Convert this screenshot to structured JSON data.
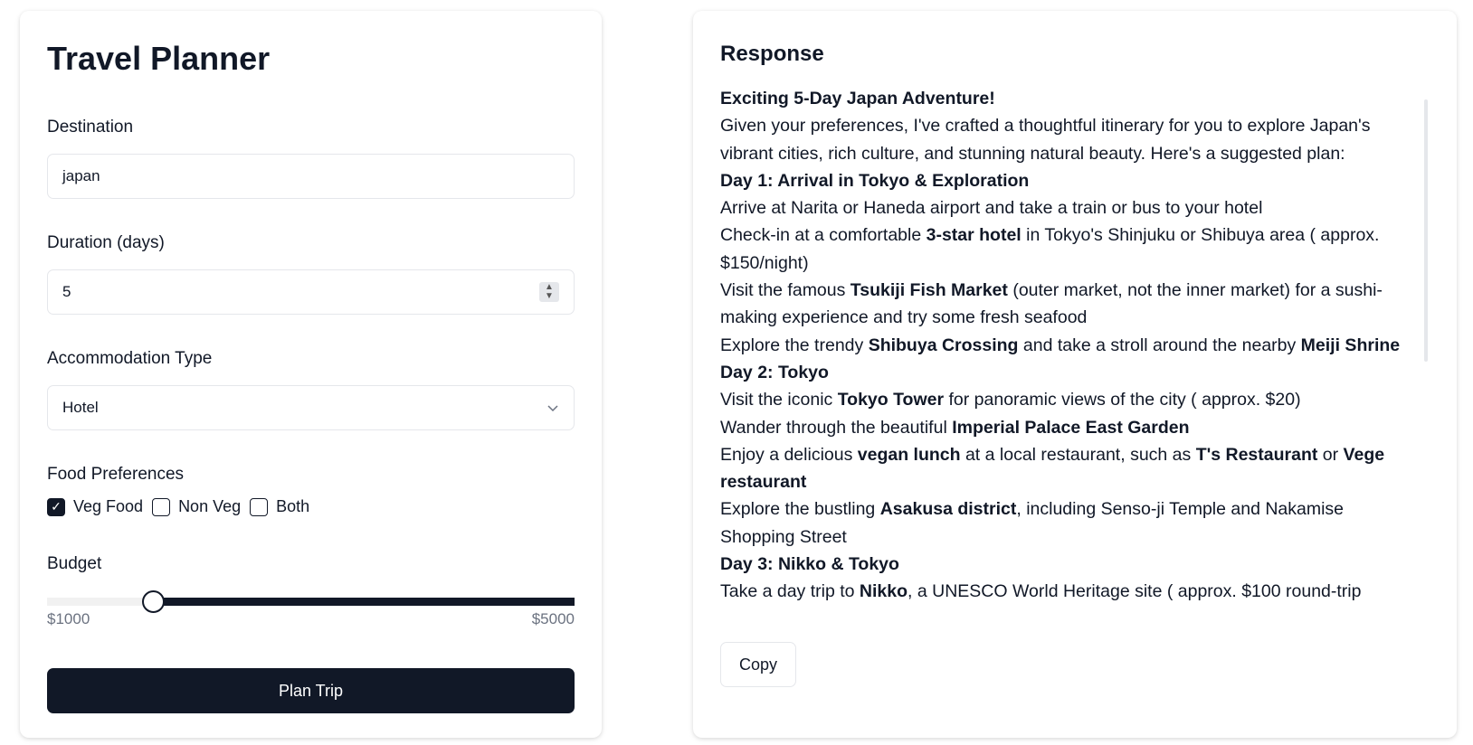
{
  "planner": {
    "title": "Travel Planner",
    "destination": {
      "label": "Destination",
      "value": "japan"
    },
    "duration": {
      "label": "Duration (days)",
      "value": "5"
    },
    "accommodation": {
      "label": "Accommodation Type",
      "value": "Hotel"
    },
    "food": {
      "label": "Food Preferences",
      "options": [
        {
          "label": "Veg Food",
          "checked": true
        },
        {
          "label": "Non Veg",
          "checked": false
        },
        {
          "label": "Both",
          "checked": false
        }
      ]
    },
    "budget": {
      "label": "Budget",
      "min_label": "$1000",
      "max_label": "$5000",
      "min": 1000,
      "max": 5000,
      "value": 1800
    },
    "submit_label": "Plan Trip"
  },
  "response": {
    "title": "Response",
    "copy_label": "Copy",
    "lines": [
      [
        {
          "t": "Exciting 5-Day Japan Adventure!",
          "b": true
        }
      ],
      [
        {
          "t": "Given your preferences, I've crafted a thoughtful itinerary for you to explore Japan's vibrant cities, rich culture, and stunning natural beauty. Here's a suggested plan:"
        }
      ],
      [
        {
          "t": "Day 1: Arrival in Tokyo & Exploration",
          "b": true
        }
      ],
      [
        {
          "t": "Arrive at Narita or Haneda airport and take a train or bus to your hotel"
        }
      ],
      [
        {
          "t": "Check-in at a comfortable "
        },
        {
          "t": "3-star hotel",
          "b": true
        },
        {
          "t": " in Tokyo's Shinjuku or Shibuya area ( approx. $150/night)"
        }
      ],
      [
        {
          "t": "Visit the famous "
        },
        {
          "t": "Tsukiji Fish Market",
          "b": true
        },
        {
          "t": " (outer market, not the inner market) for a sushi-making experience and try some fresh seafood"
        }
      ],
      [
        {
          "t": "Explore the trendy "
        },
        {
          "t": "Shibuya Crossing",
          "b": true
        },
        {
          "t": " and take a stroll around the nearby "
        },
        {
          "t": "Meiji Shrine",
          "b": true
        }
      ],
      [
        {
          "t": "Day 2: Tokyo",
          "b": true
        }
      ],
      [
        {
          "t": "Visit the iconic "
        },
        {
          "t": "Tokyo Tower",
          "b": true
        },
        {
          "t": " for panoramic views of the city ( approx. $20)"
        }
      ],
      [
        {
          "t": "Wander through the beautiful "
        },
        {
          "t": "Imperial Palace East Garden",
          "b": true
        }
      ],
      [
        {
          "t": "Enjoy a delicious "
        },
        {
          "t": "vegan lunch",
          "b": true
        },
        {
          "t": " at a local restaurant, such as "
        },
        {
          "t": "T's Restaurant",
          "b": true
        },
        {
          "t": " or "
        },
        {
          "t": "Vege restaurant",
          "b": true
        }
      ],
      [
        {
          "t": "Explore the bustling "
        },
        {
          "t": "Asakusa district",
          "b": true
        },
        {
          "t": ", including Senso-ji Temple and Nakamise Shopping Street"
        }
      ],
      [
        {
          "t": "Day 3: Nikko & Tokyo",
          "b": true
        }
      ],
      [
        {
          "t": "Take a day trip to "
        },
        {
          "t": "Nikko",
          "b": true
        },
        {
          "t": ", a UNESCO World Heritage site ( approx. $100 round-trip"
        }
      ]
    ]
  }
}
